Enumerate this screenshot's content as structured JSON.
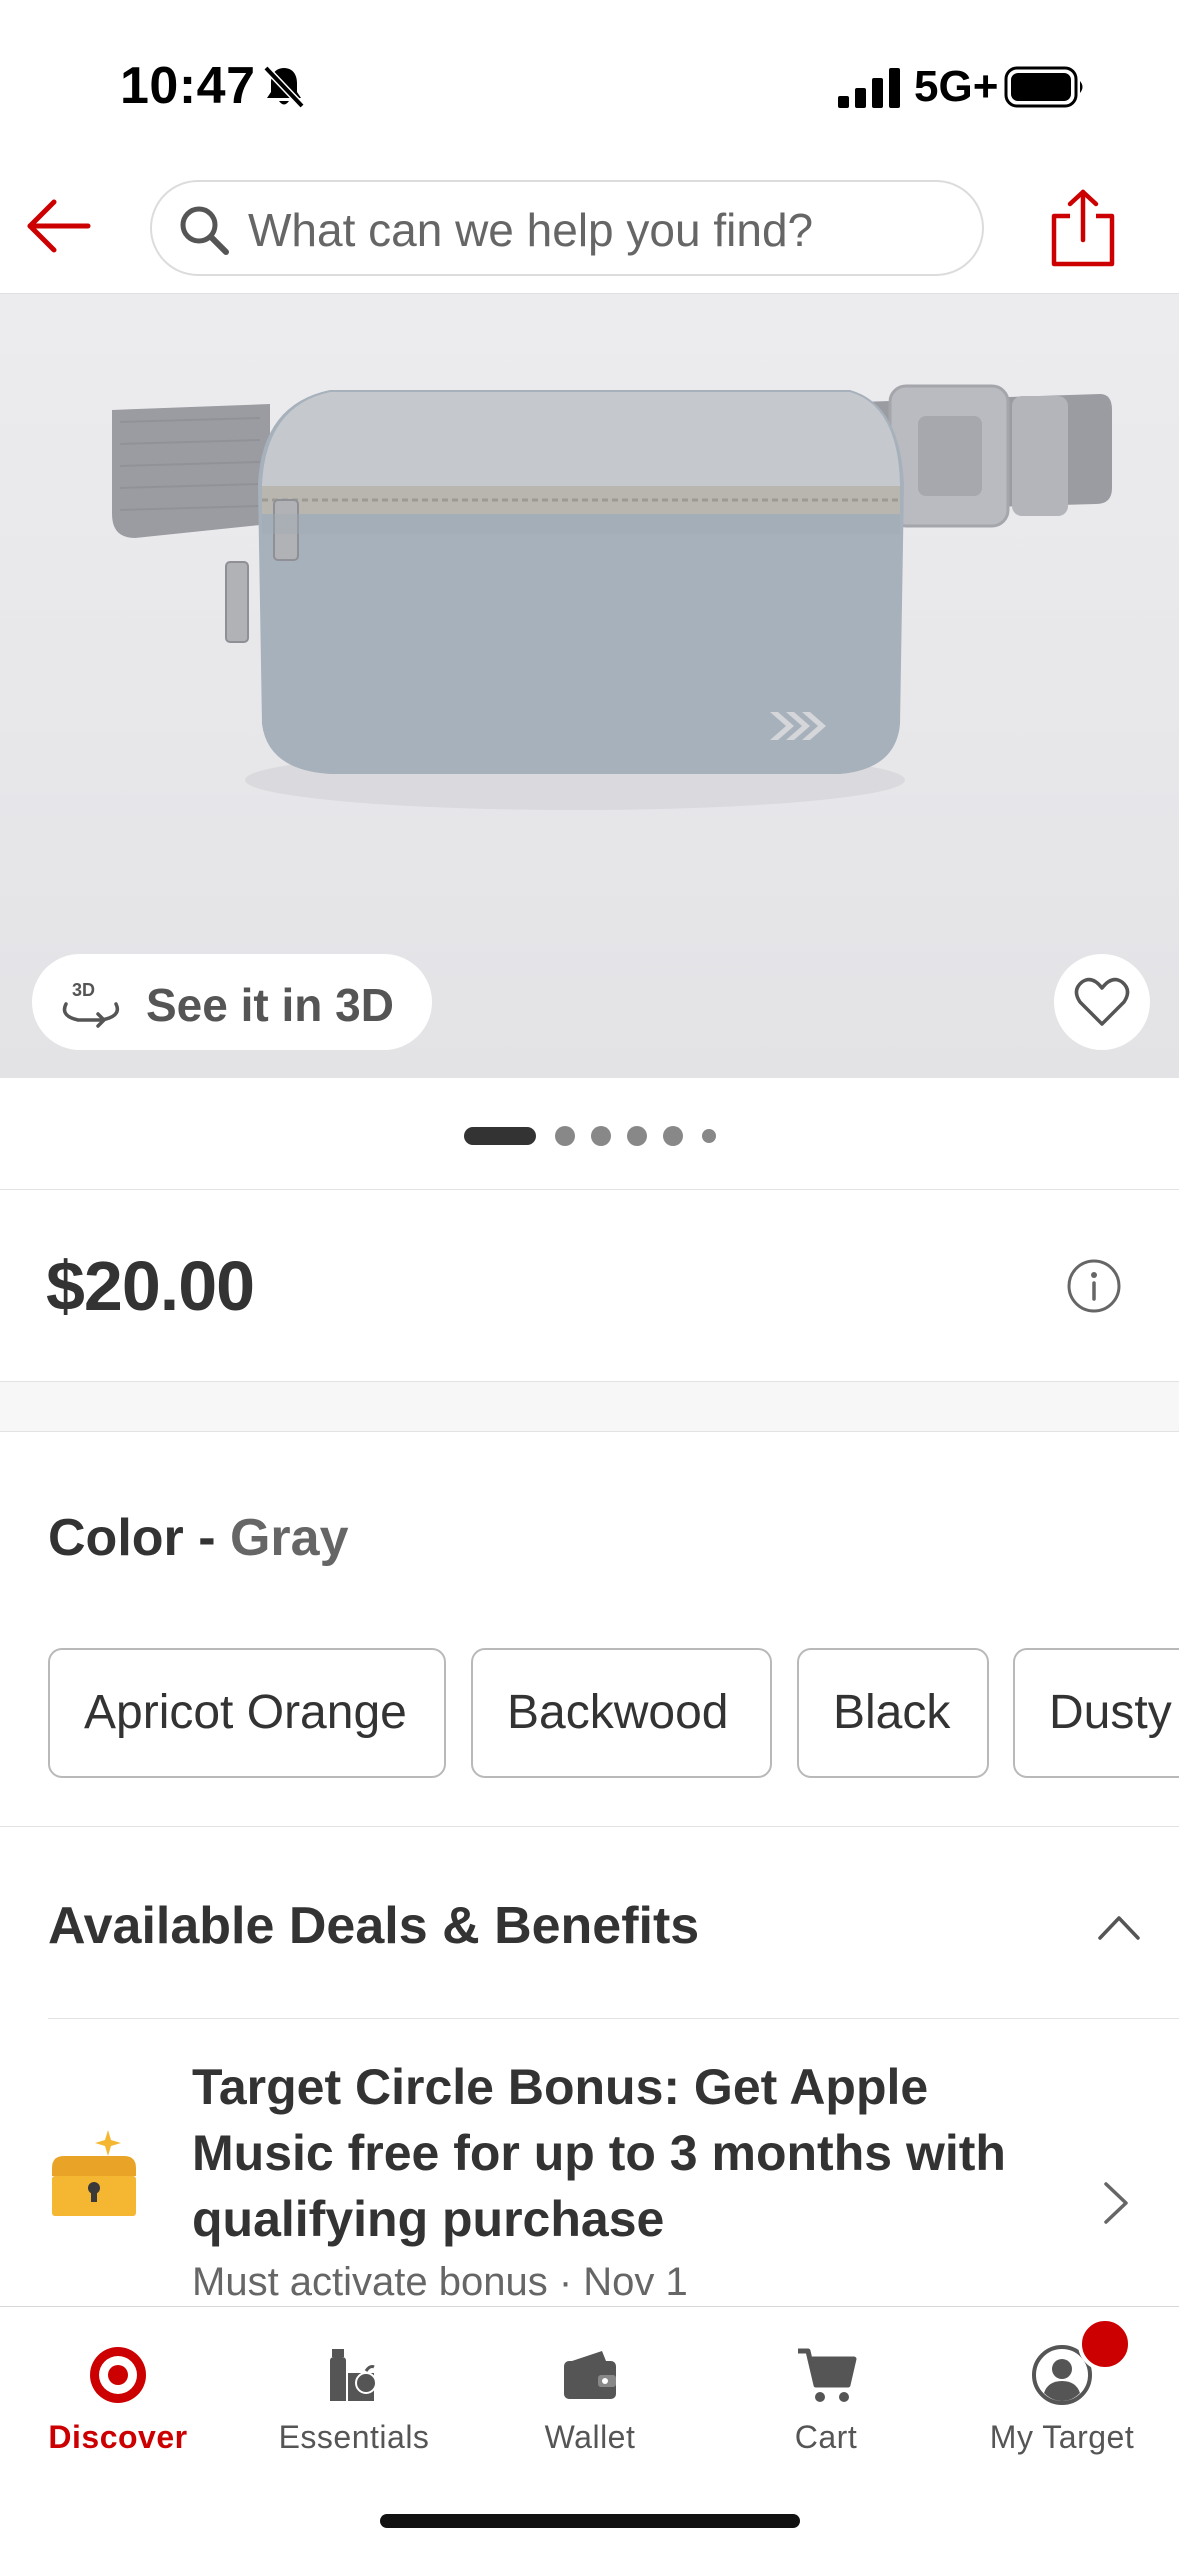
{
  "status_bar": {
    "time": "10:47",
    "network": "5G+",
    "icons": [
      "bell-slash-icon",
      "signal-icon",
      "battery-icon"
    ]
  },
  "header": {
    "search_placeholder": "What can we help you find?",
    "icons": [
      "back-arrow-icon",
      "search-icon",
      "share-icon"
    ]
  },
  "hero": {
    "see_in_3d_label": "See it in 3D",
    "cube_glyph": "3D",
    "image_count": 6,
    "active_image_index": 0
  },
  "price": {
    "value": "$20.00"
  },
  "color": {
    "label": "Color",
    "separator": " - ",
    "selected": "Gray",
    "options": [
      "Apricot Orange",
      "Backwood",
      "Black",
      "Dusty"
    ]
  },
  "deals": {
    "heading": "Available Deals & Benefits",
    "items": [
      {
        "title": "Target Circle Bonus: Get Apple Music free for up to 3 months with qualifying purchase",
        "subtitle": "Must activate bonus · Nov 1"
      }
    ]
  },
  "tabbar": {
    "tabs": [
      {
        "label": "Discover",
        "icon": "target-logo-icon",
        "active": true
      },
      {
        "label": "Essentials",
        "icon": "essentials-icon",
        "active": false
      },
      {
        "label": "Wallet",
        "icon": "wallet-icon",
        "active": false
      },
      {
        "label": "Cart",
        "icon": "cart-icon",
        "active": false
      },
      {
        "label": "My Target",
        "icon": "profile-icon",
        "active": false,
        "notification": true
      }
    ]
  },
  "colors": {
    "brand_red": "#cc0000",
    "text_primary": "#333333",
    "text_secondary": "#666666"
  }
}
